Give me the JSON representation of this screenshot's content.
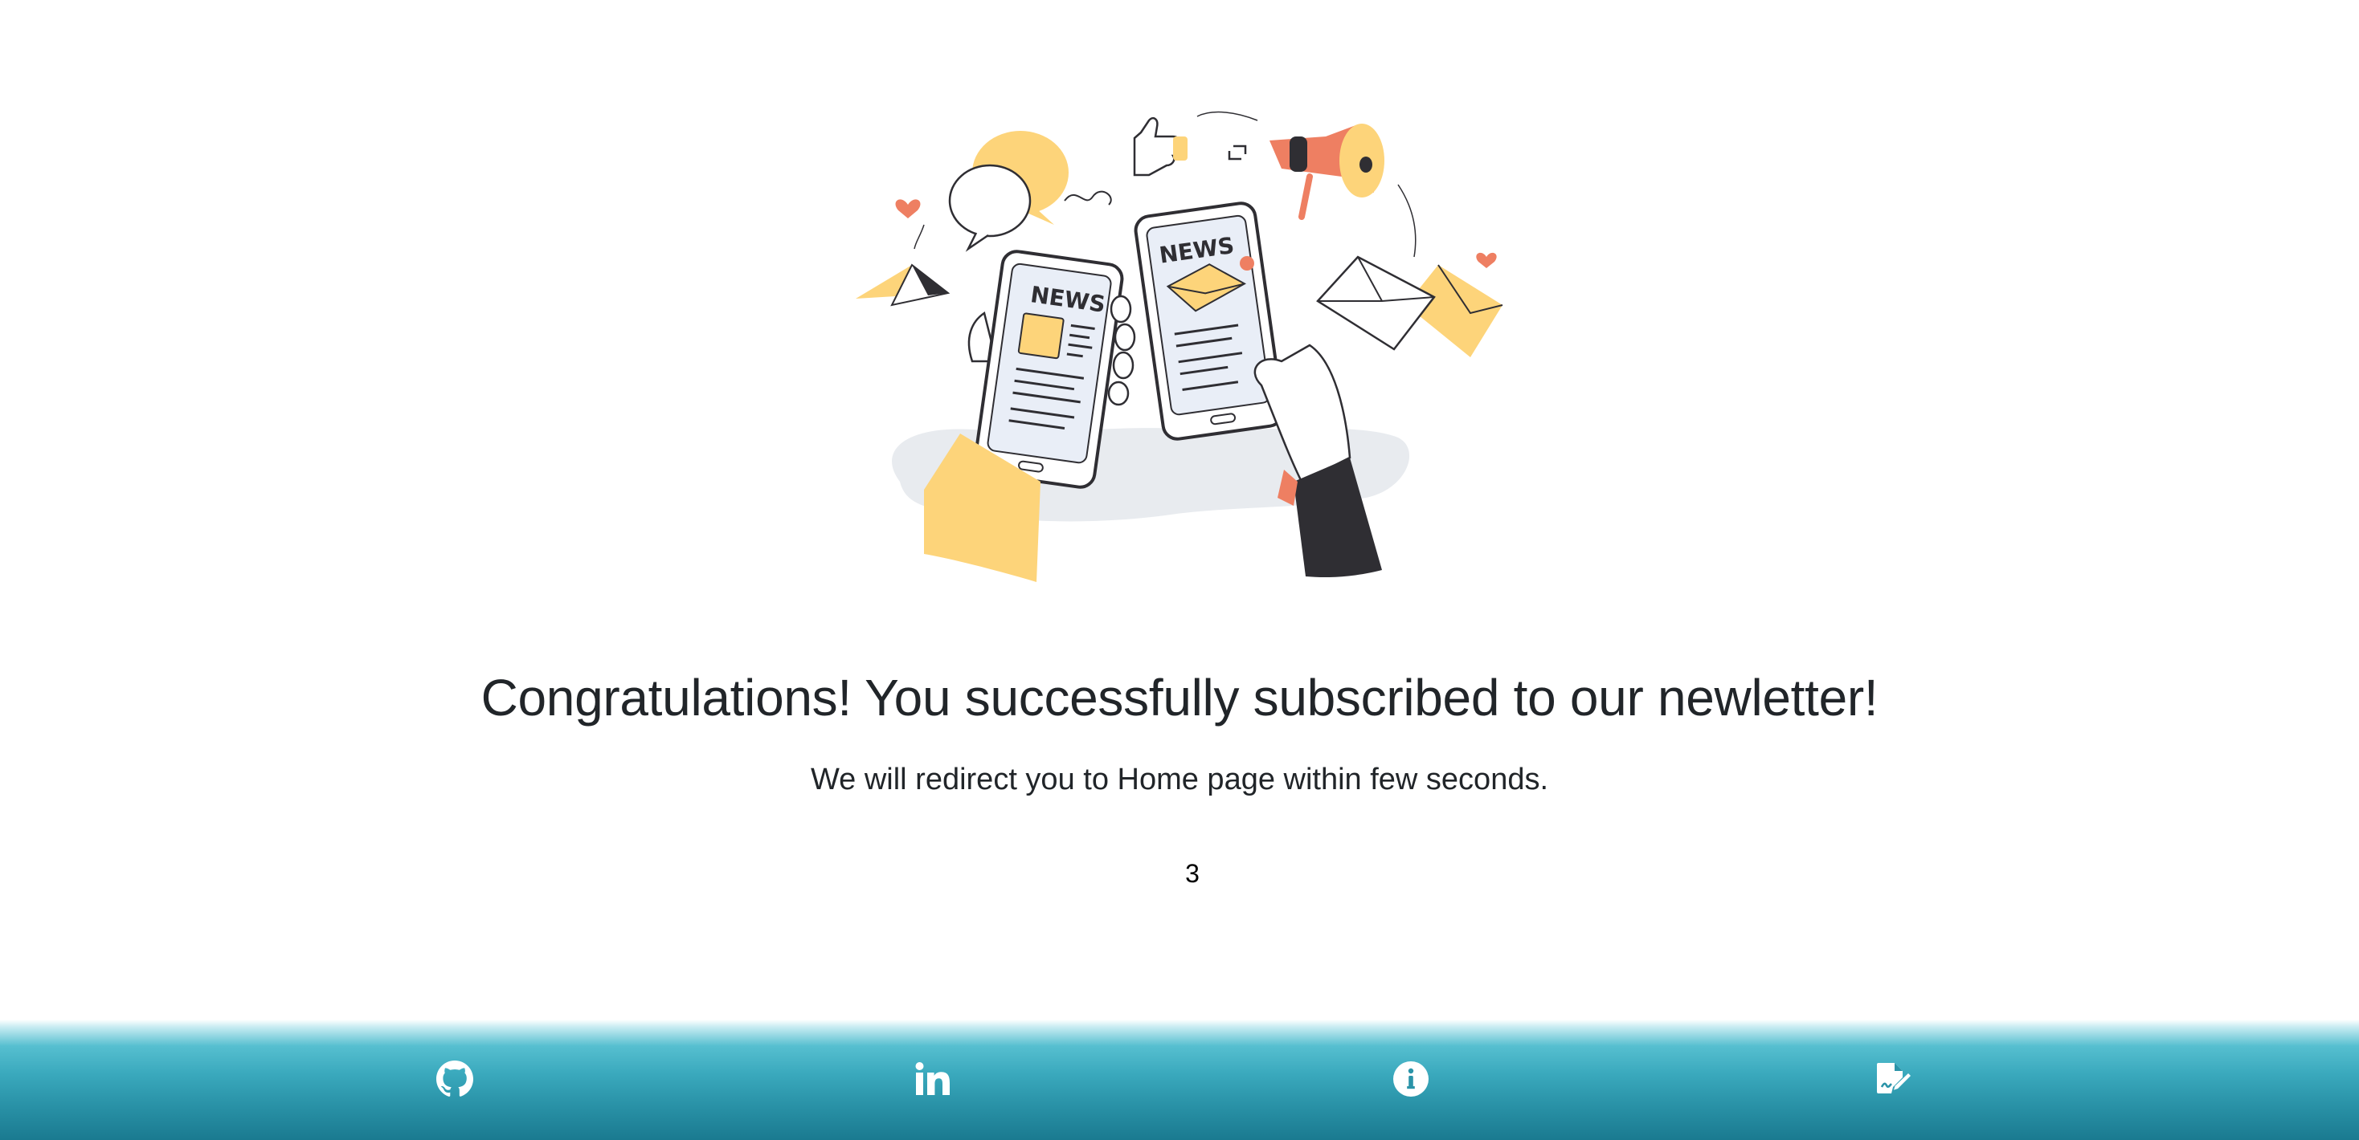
{
  "hero": {
    "illustration": "newsletter-news-tablets-illustration",
    "news_label_left": "NEWS",
    "news_label_right": "NEWS"
  },
  "message": {
    "title": "Congratulations! You successfully subscribed to our newletter!",
    "subtitle": "We will redirect you to Home page within few seconds.",
    "countdown": "3"
  },
  "footer": {
    "links": [
      {
        "icon": "github-icon"
      },
      {
        "icon": "linkedin-icon"
      },
      {
        "icon": "info-icon"
      },
      {
        "icon": "signature-document-icon"
      }
    ],
    "colors": {
      "gradient_top": "#56bfd0",
      "gradient_bottom": "#1a7a90",
      "icon": "#ffffff"
    }
  },
  "colors": {
    "text": "#212529",
    "accent_yellow": "#fdd47a",
    "accent_coral": "#ee7f62",
    "dark": "#2f2e33"
  }
}
